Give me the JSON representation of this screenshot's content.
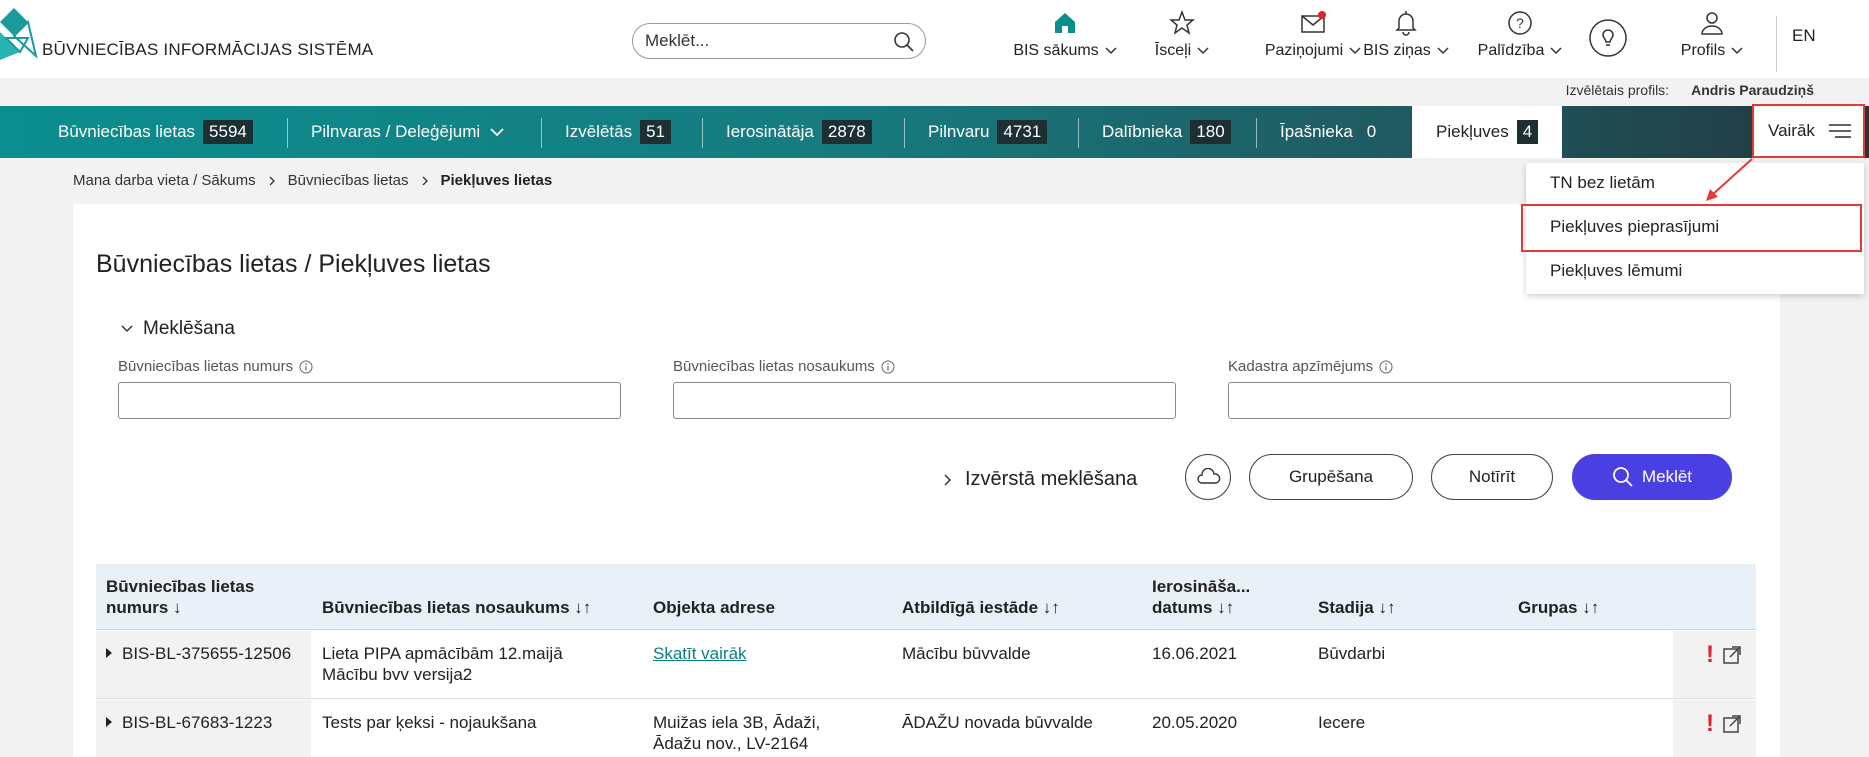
{
  "header": {
    "app_title": "BŪVNIECĪBAS INFORMĀCIJAS SISTĒMA",
    "search_placeholder": "Meklēt...",
    "nav": [
      {
        "label": "BIS sākums",
        "icon": "home-icon"
      },
      {
        "label": "Īsceļi",
        "icon": "star-icon"
      },
      {
        "label": "Paziņojumi",
        "icon": "mail-icon"
      },
      {
        "label": "BIS ziņas",
        "icon": "bell-icon"
      },
      {
        "label": "Palīdzība",
        "icon": "help-icon"
      },
      {
        "label": "",
        "icon": "lightbulb-icon"
      },
      {
        "label": "Profils",
        "icon": "user-icon"
      }
    ],
    "language": "EN",
    "profile_label": "Izvēlētais profils:",
    "profile_name": "Andris Paraudziņš",
    "colors": {
      "accent": "#0b8e8e",
      "primary_button": "#4a3fe0",
      "highlight": "#e53935",
      "notification_dot": "#e0222e"
    }
  },
  "tabs": [
    {
      "label": "Būvniecības lietas",
      "count": "5594"
    },
    {
      "label": "Pilnvaras / Deleģējumi",
      "count": ""
    },
    {
      "label": "Izvēlētās",
      "count": "51"
    },
    {
      "label": "Ierosinātāja",
      "count": "2878"
    },
    {
      "label": "Pilnvaru",
      "count": "4731"
    },
    {
      "label": "Dalībnieka",
      "count": "180"
    },
    {
      "label": "Īpašnieka",
      "count": "0"
    },
    {
      "label": "Piekļuves",
      "count": "4",
      "active": true
    }
  ],
  "more_label": "Vairāk",
  "more_menu": [
    "TN bez lietām",
    "Piekļuves pieprasījumi",
    "Piekļuves lēmumi"
  ],
  "breadcrumb": [
    "Mana darba vieta / Sākums",
    "Būvniecības lietas",
    "Piekļuves lietas"
  ],
  "page_title": "Būvniecības lietas / Piekļuves lietas",
  "search_section": {
    "title": "Meklēšana",
    "fields": [
      {
        "label": "Būvniecības lietas numurs",
        "value": ""
      },
      {
        "label": "Būvniecības lietas nosaukums",
        "value": ""
      },
      {
        "label": "Kadastra apzīmējums",
        "value": ""
      }
    ],
    "advanced_label": "Izvērstā meklēšana",
    "group_button": "Grupēšana",
    "clear_button": "Notīrīt",
    "search_button": "Meklēt"
  },
  "table": {
    "headers": [
      "Būvniecības lietas numurs ↓",
      "Būvniecības lietas nosaukums ↓↑",
      "Objekta adrese",
      "Atbildīgā iestāde ↓↑",
      "Ierosināša... datums ↓↑",
      "Stadija ↓↑",
      "Grupas ↓↑"
    ],
    "rows": [
      {
        "number": "BIS-BL-375655-12506",
        "name": "Lieta PIPA apmācībām 12.maijā Mācību bvv versija2",
        "address": "Skatīt vairāk",
        "authority": "Mācību būvvalde",
        "date": "16.06.2021",
        "stage": "Būvdarbi",
        "groups": "",
        "flag": "!"
      },
      {
        "number": "BIS-BL-67683-1223",
        "name": "Tests par ķeksi - nojaukšana",
        "address": "Muižas iela 3B, Ādaži, Ādažu nov., LV-2164",
        "authority": "ĀDAŽU novada būvvalde",
        "date": "20.05.2020",
        "stage": "Iecere",
        "groups": "",
        "flag": "!"
      }
    ]
  }
}
